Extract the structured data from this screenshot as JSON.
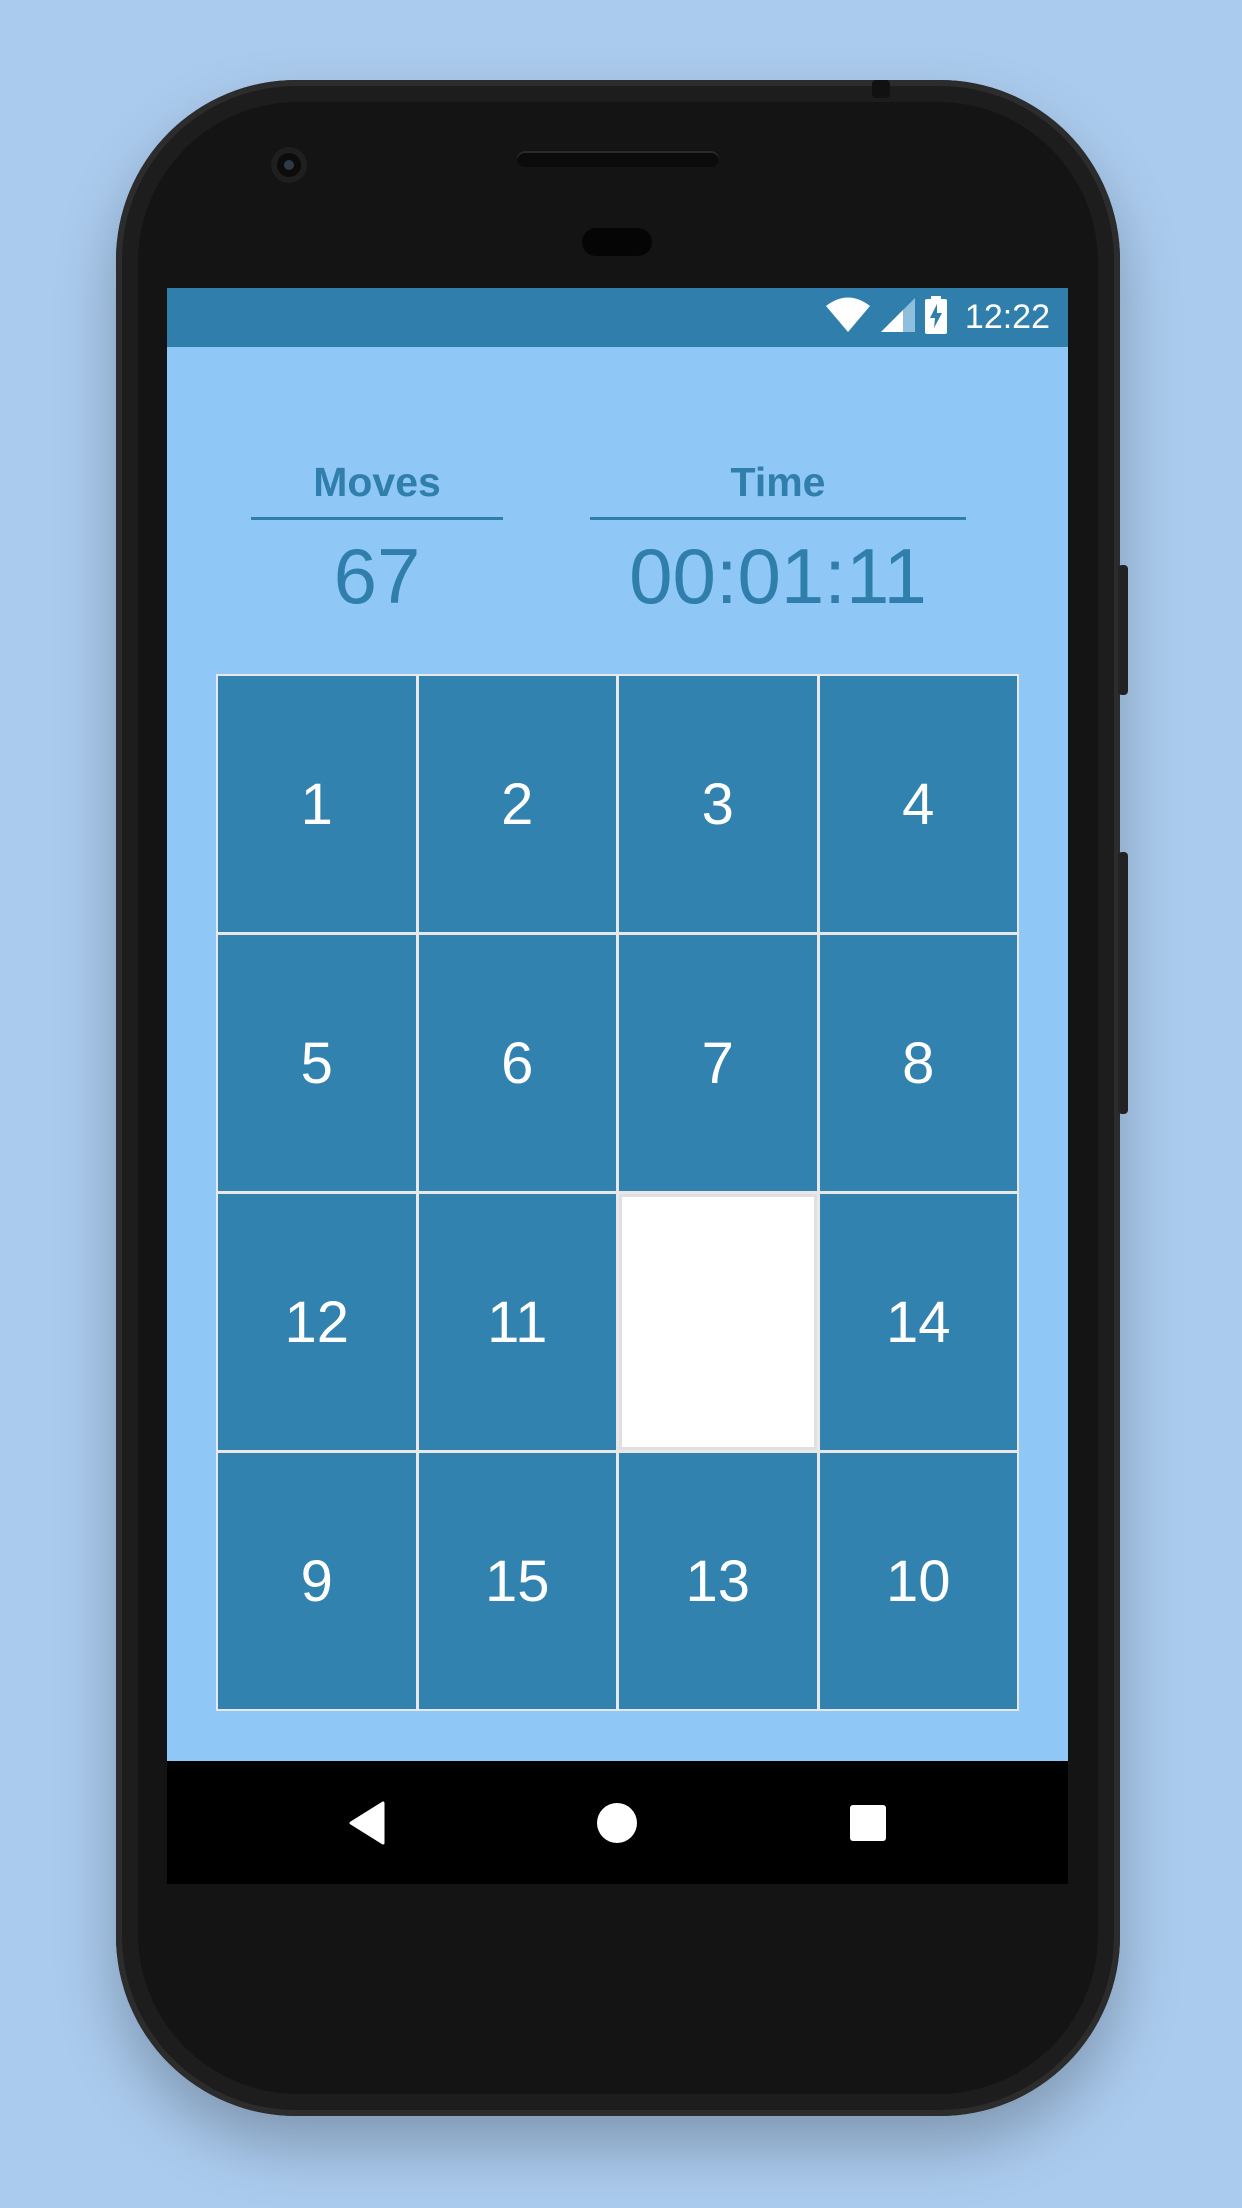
{
  "status_bar": {
    "time": "12:22",
    "icons": [
      "wifi-icon",
      "cell-signal-icon",
      "battery-charging-icon"
    ]
  },
  "stats": {
    "moves_label": "Moves",
    "moves_value": "67",
    "time_label": "Time",
    "time_value": "00:01:11"
  },
  "board": {
    "tiles": [
      "1",
      "2",
      "3",
      "4",
      "5",
      "6",
      "7",
      "8",
      "12",
      "11",
      "",
      "14",
      "9",
      "15",
      "13",
      "10"
    ]
  },
  "nav_bar": {
    "icons": [
      "back-icon",
      "home-icon",
      "recents-icon"
    ]
  },
  "colors": {
    "background": "#abcbee",
    "app_background": "#8fc8f6",
    "accent": "#2f7eab",
    "tile": "#3182af",
    "empty_tile": "#ffffff"
  }
}
